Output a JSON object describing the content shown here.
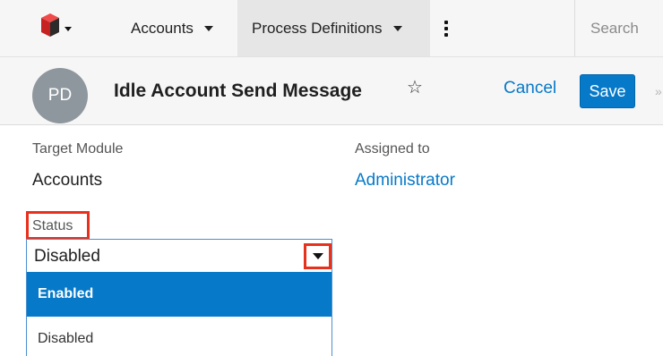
{
  "nav": {
    "logo_icon": "sugar-cube-logo-icon",
    "tabs": [
      {
        "label": "Accounts"
      },
      {
        "label": "Process Definitions"
      }
    ],
    "more_icon": "vertical-ellipsis-icon",
    "search": {
      "placeholder": "Search",
      "value": ""
    }
  },
  "record": {
    "avatar_initials": "PD",
    "name": "Idle Account Send Message",
    "favorite_icon": "star-outline-icon",
    "cancel_label": "Cancel",
    "save_label": "Save",
    "toggle_icon": "double-chevron-right-icon"
  },
  "fields": {
    "target_module": {
      "label": "Target Module",
      "value": "Accounts"
    },
    "assigned_to": {
      "label": "Assigned to",
      "value": "Administrator"
    },
    "status": {
      "label": "Status",
      "selected": "Disabled",
      "options": [
        {
          "label": "Enabled",
          "highlighted": true
        },
        {
          "label": "Disabled",
          "highlighted": false
        }
      ]
    }
  },
  "colors": {
    "accent": "#0679c8",
    "highlight_box": "#e8311d",
    "nav_bg": "#f6f6f6",
    "active_tab_bg": "#e6e6e6",
    "avatar_bg": "#8f979e"
  }
}
